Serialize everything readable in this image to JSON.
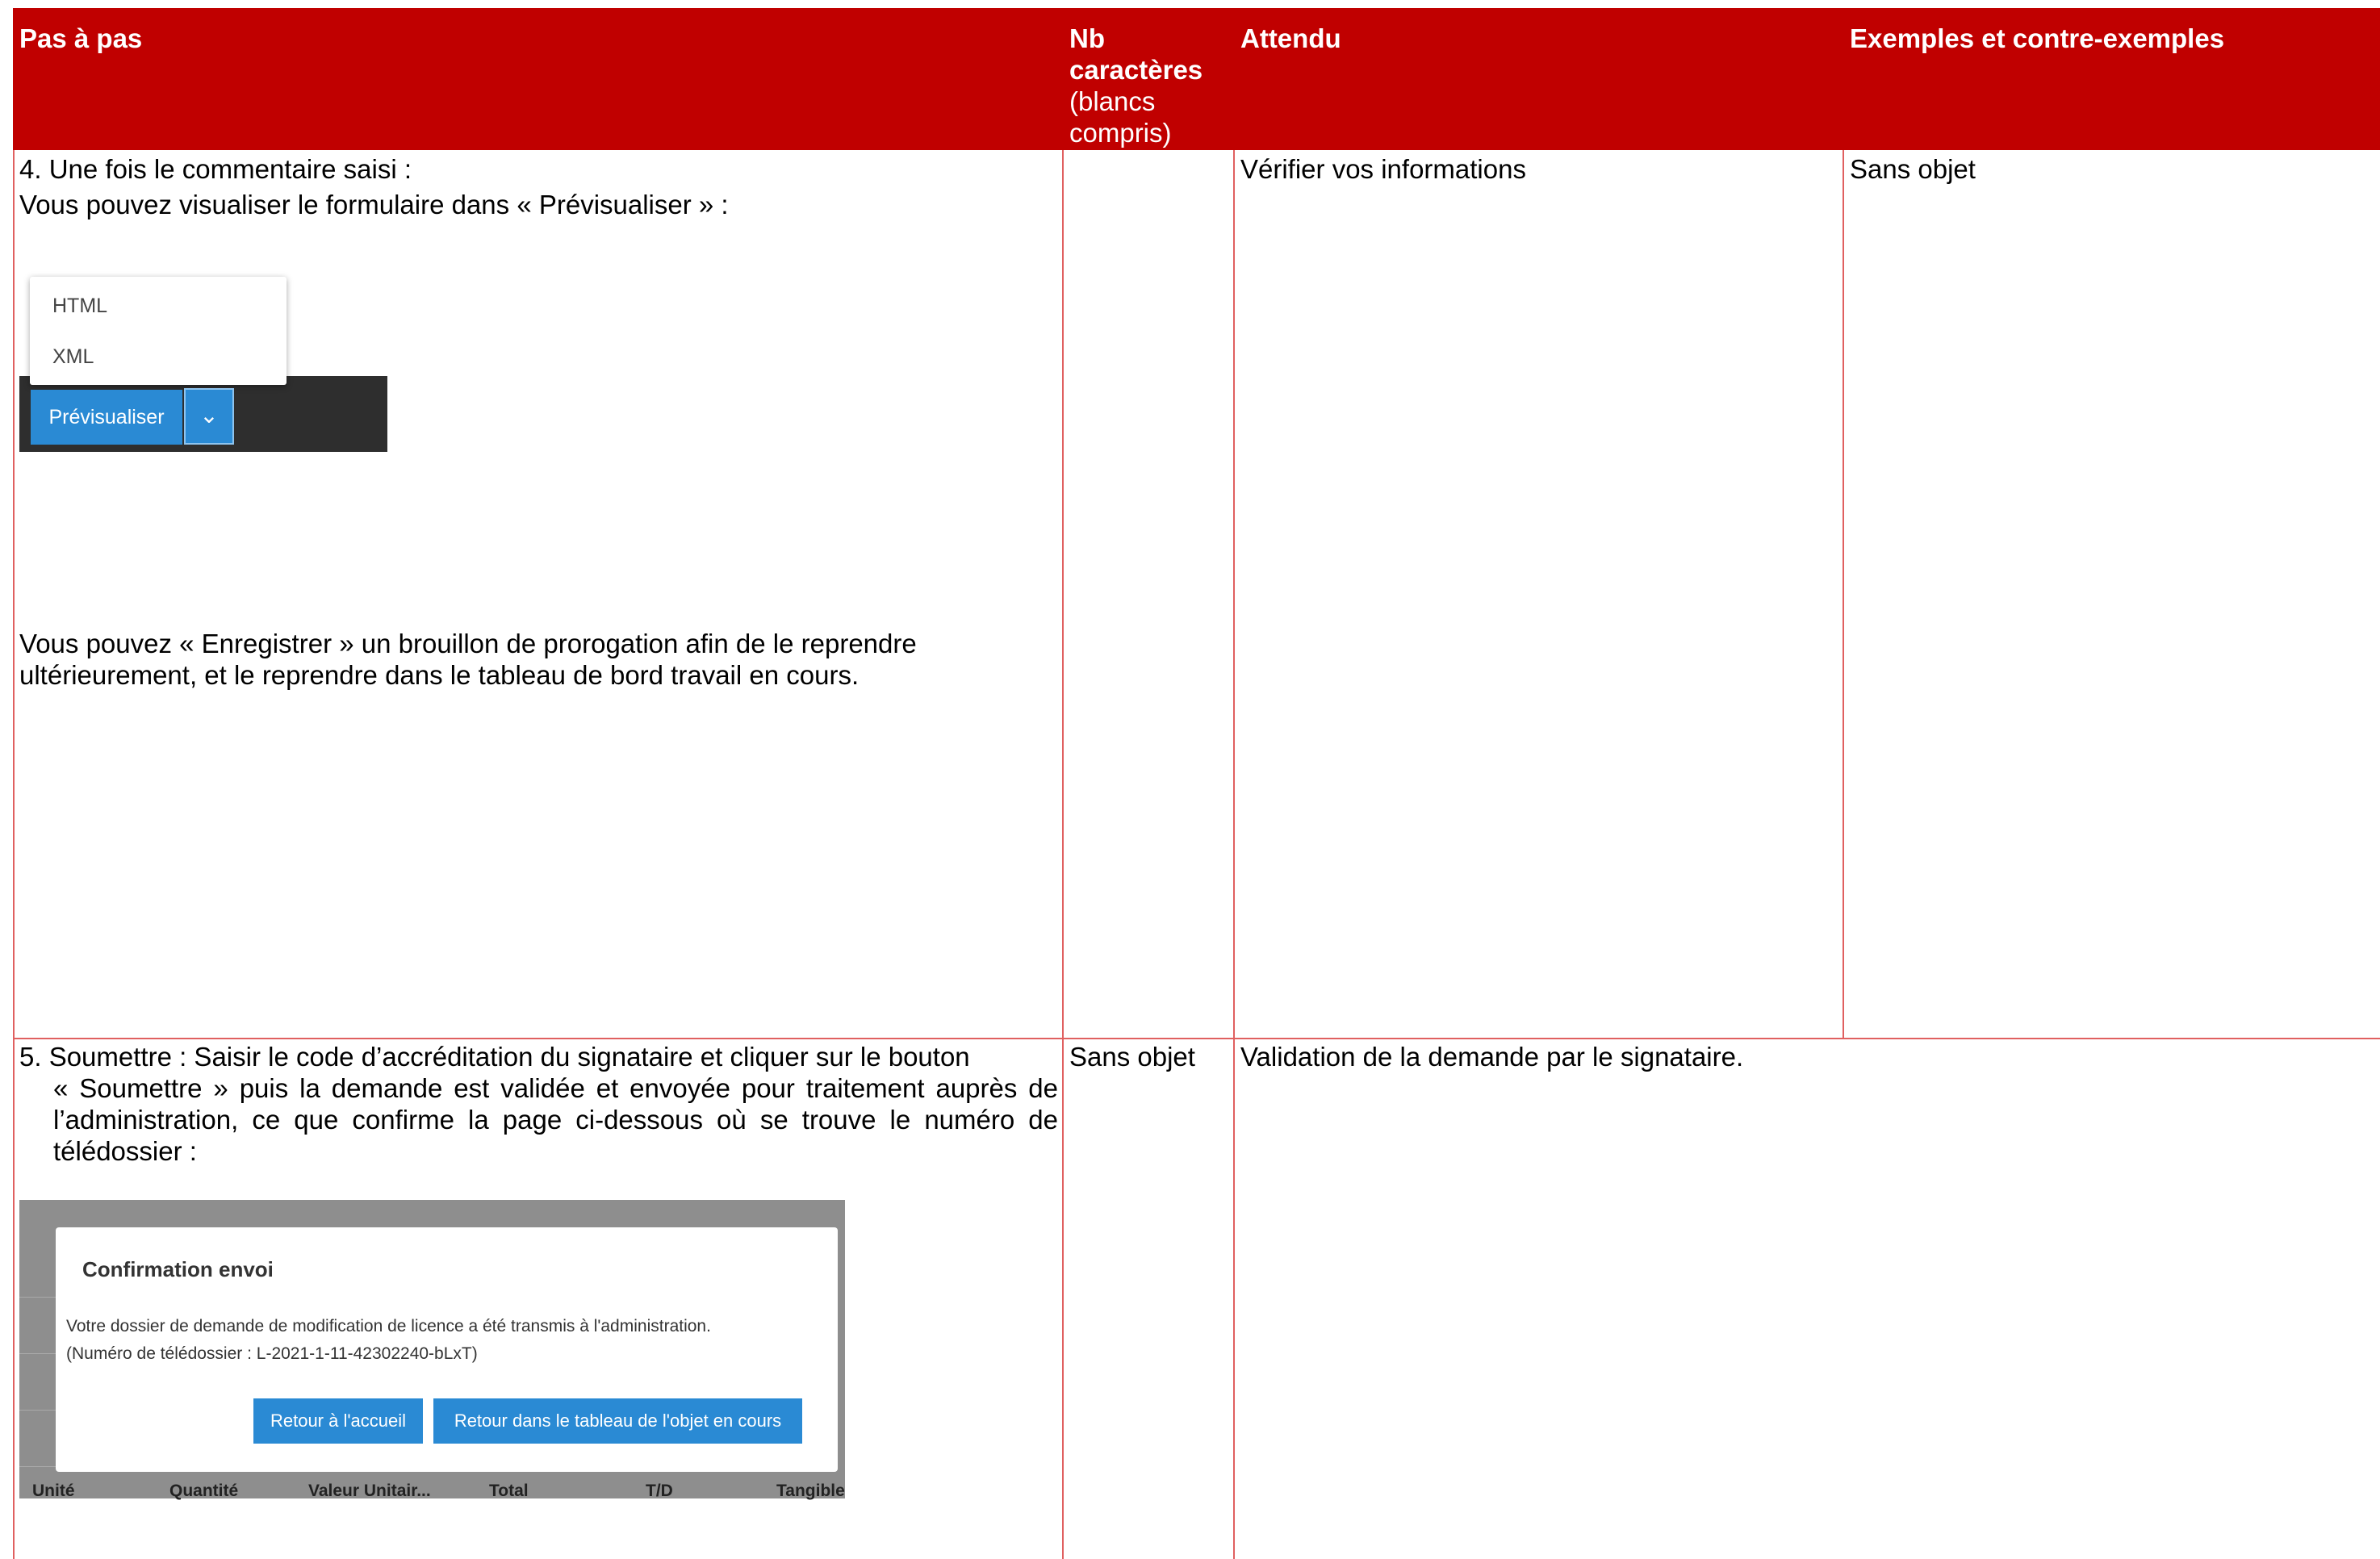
{
  "header": {
    "col1": "Pas à pas",
    "col2_bold": "Nb caractères",
    "col2_sub": "(blancs compris)",
    "col3": "Attendu",
    "col4": "Exemples et contre-exemples"
  },
  "row4": {
    "line1": "4.  Une fois le commentaire saisi :",
    "line2": "Vous pouvez visualiser le formulaire dans « Prévisualiser » :",
    "para2": "Vous pouvez  « Enregistrer » un brouillon de prorogation afin de le reprendre ultérieurement, et le reprendre dans le tableau de bord travail en cours.",
    "attendu": "Vérifier vos informations",
    "exemples": "Sans objet",
    "preview": {
      "menu_items": [
        "HTML",
        "XML"
      ],
      "button": "Prévisualiser",
      "caret_icon": "chevron-down-icon"
    }
  },
  "row5": {
    "line1": "5. Soumettre : Saisir le code d’accréditation du signataire et cliquer sur le bouton",
    "line2": "« Soumettre » puis la demande est validée et envoyée pour traitement auprès de l’administration, ce que confirme la page ci-dessous où se trouve le numéro de télédossier :",
    "nb": "Sans objet",
    "attendu": "Validation de la demande par le signataire.",
    "confirm": {
      "title": "Confirmation envoi",
      "msg1": "Votre dossier de demande de modification de licence a été transmis à l'administration.",
      "msg2": "(Numéro de télédossier : L-2021-1-11-42302240-bLxT)",
      "btn_home": "Retour à l'accueil",
      "btn_board": "Retour dans le tableau de l'objet en cours",
      "columns": [
        "Unité",
        "Quantité",
        "Valeur Unitair...",
        "Total",
        "T/D",
        "Tangible"
      ]
    }
  },
  "colors": {
    "header_bg": "#c00000",
    "grid": "#e06060"
  }
}
